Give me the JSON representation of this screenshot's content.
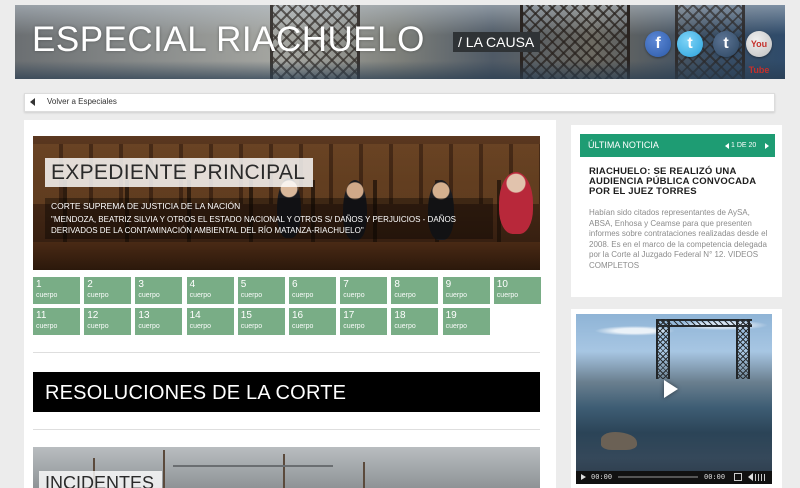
{
  "header": {
    "site_title": "ESPECIAL RIACHUELO",
    "section_tag": "/ LA CAUSA",
    "social": {
      "facebook": "f",
      "twitter": "t",
      "tumblr": "t",
      "youtube": "You Tube"
    }
  },
  "nav": {
    "back_label": "Volver a Especiales"
  },
  "main": {
    "hero": {
      "title": "EXPEDIENTE PRINCIPAL",
      "court": "CORTE SUPREMA DE JUSTICIA DE LA NACIÓN",
      "case": "\"MENDOZA, BEATRIZ SILVIA Y OTROS EL ESTADO NACIONAL Y OTROS S/ DAÑOS Y PERJUICIOS - DAÑOS DERIVADOS DE LA CONTAMINACIÓN AMBIENTAL DEL RÍO MATANZA-RIACHUELO\""
    },
    "cuerpo_label": "cuerpo",
    "cuerpos": [
      "1",
      "2",
      "3",
      "4",
      "5",
      "6",
      "7",
      "8",
      "9",
      "10",
      "11",
      "12",
      "13",
      "14",
      "15",
      "16",
      "17",
      "18",
      "19"
    ],
    "resoluciones_title": "RESOLUCIONES DE LA CORTE",
    "incidentes_title": "INCIDENTES"
  },
  "news": {
    "header_label": "ÚLTIMA NOTICIA",
    "pager": "1 DE 20",
    "title": "RIACHUELO: SE REALIZÓ UNA AUDIENCIA PÚBLICA CONVOCADA POR EL JUEZ TORRES",
    "body": "Habían sido citados representantes de AySA, ABSA, Enhosa y Ceamse para que presenten informes sobre contrataciones realizadas desde el 2008. Es en el marco de la competencia delegada por la Corte al Juzgado Federal N° 12. VIDEOS COMPLETOS"
  },
  "video": {
    "time_current": "00:00",
    "time_total": "00:00"
  },
  "colors": {
    "accent_green": "#1e9c73",
    "cuerpo_green": "#79ad86"
  },
  "icons": [
    "facebook-icon",
    "twitter-icon",
    "tumblr-icon",
    "youtube-icon",
    "back-arrow-icon",
    "play-icon",
    "fullscreen-icon",
    "volume-icon"
  ]
}
